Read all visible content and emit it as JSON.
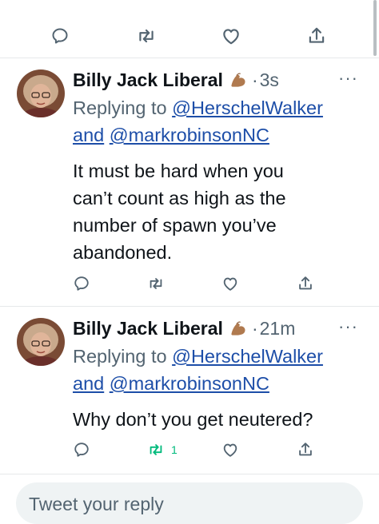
{
  "colors": {
    "text": "#0f1419",
    "muted": "#536471",
    "link": "#1d4ea8",
    "retweet_active": "#00ba7c",
    "divider": "#e6e9ea",
    "reply_bg": "#eff3f4"
  },
  "top_actions": {
    "icons": [
      "reply-icon",
      "retweet-icon",
      "like-icon",
      "share-icon"
    ]
  },
  "tweets": [
    {
      "author": "Billy Jack Liberal",
      "emoji": "flexed-biceps-icon",
      "separator": "·",
      "time": "3s",
      "more": "···",
      "replying_prefix": "Replying to",
      "mention_1": "@HerschelWalker",
      "conjunction": "and",
      "mention_2": "@markrobinsonNC",
      "text_lines": [
        "It must be hard when you",
        "can’t count as high as the",
        "number of spawn you’ve",
        "abandoned."
      ],
      "retweet_count": ""
    },
    {
      "author": "Billy Jack Liberal",
      "emoji": "flexed-biceps-icon",
      "separator": "·",
      "time": "21m",
      "more": "···",
      "replying_prefix": "Replying to",
      "mention_1": "@HerschelWalker",
      "conjunction": "and",
      "mention_2": "@markrobinsonNC",
      "text_lines": [
        "Why don’t you get neutered?"
      ],
      "retweet_count": "1"
    }
  ],
  "reply_box": {
    "placeholder": "Tweet your reply"
  }
}
